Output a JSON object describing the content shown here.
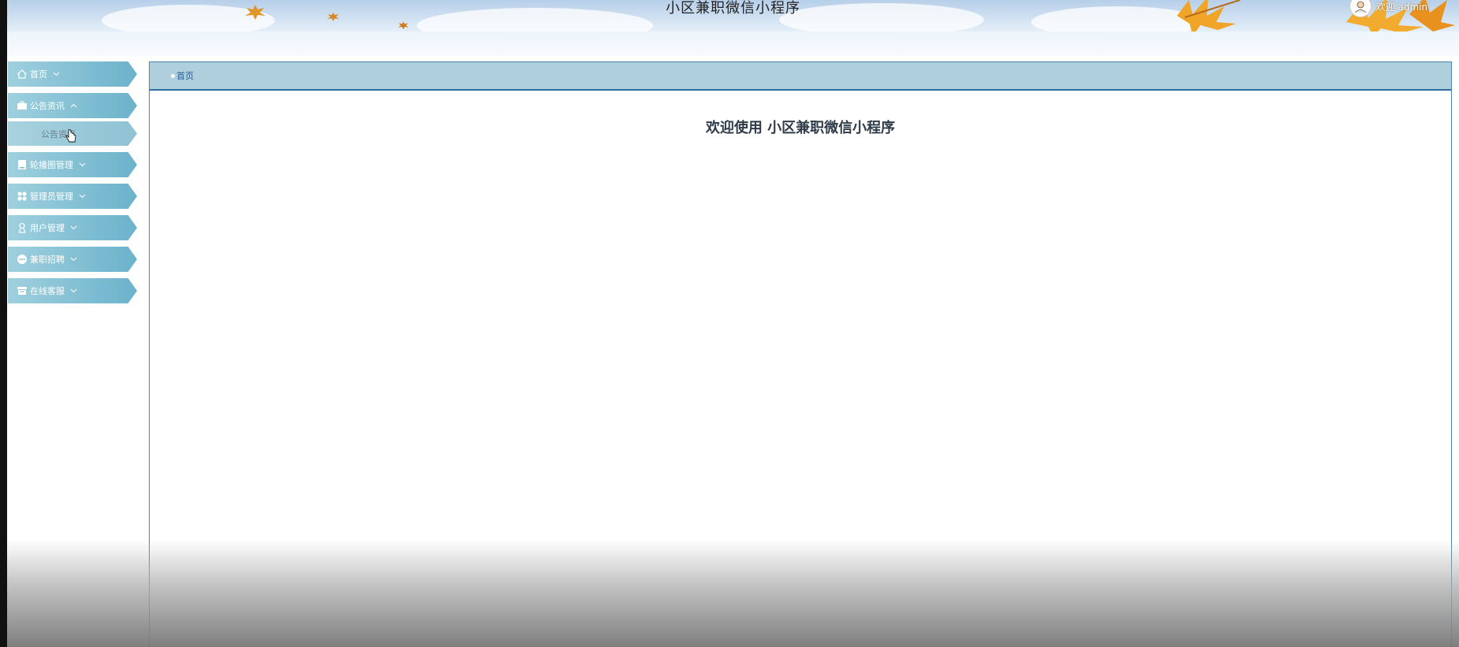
{
  "header": {
    "title": "小区兼职微信小程序",
    "welcome_text": "欢迎 admin"
  },
  "breadcrumb": {
    "home": "首页"
  },
  "main": {
    "welcome_title": "欢迎使用 小区兼职微信小程序"
  },
  "sidebar": {
    "items": [
      {
        "label": "首页",
        "icon": "home-icon"
      },
      {
        "label": "公告资讯",
        "icon": "briefcase-icon"
      },
      {
        "label": "轮播图管理",
        "icon": "image-icon"
      },
      {
        "label": "管理员管理",
        "icon": "grid-icon"
      },
      {
        "label": "用户管理",
        "icon": "user-icon"
      },
      {
        "label": "兼职招聘",
        "icon": "chat-icon"
      },
      {
        "label": "在线客服",
        "icon": "archive-icon"
      }
    ],
    "sub_items": {
      "announcement": "公告资讯"
    }
  },
  "colors": {
    "sidebar_gradient_start": "#9fd0de",
    "sidebar_gradient_end": "#6bb2cb",
    "breadcrumb_bg": "#aecfdb",
    "breadcrumb_border": "#2f6f9f",
    "main_border": "#4f86ad"
  }
}
